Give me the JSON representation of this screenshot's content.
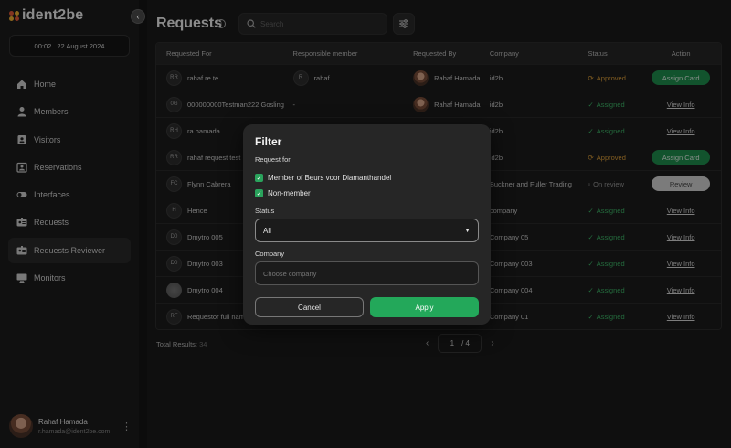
{
  "app": {
    "logo_text": "ident2be"
  },
  "sidebar": {
    "time": "00:02",
    "date": "22 August 2024",
    "items": [
      {
        "label": "Home",
        "icon": "home-icon"
      },
      {
        "label": "Members",
        "icon": "person-icon"
      },
      {
        "label": "Visitors",
        "icon": "badge-icon"
      },
      {
        "label": "Reservations",
        "icon": "calendar-person-icon"
      },
      {
        "label": "Interfaces",
        "icon": "toggle-icon"
      },
      {
        "label": "Requests",
        "icon": "id-card-icon"
      },
      {
        "label": "Requests Reviewer",
        "icon": "id-card-check-icon",
        "active": true
      },
      {
        "label": "Monitors",
        "icon": "monitor-icon"
      }
    ],
    "user": {
      "name": "Rahaf Hamada",
      "email": "r.hamada@ident2be.com"
    }
  },
  "header": {
    "title": "Requests",
    "search_placeholder": "Search"
  },
  "table": {
    "columns": [
      "Requested For",
      "Responsible member",
      "Requested By",
      "Company",
      "Status",
      "Action"
    ],
    "rows": [
      {
        "initials": "RR",
        "requested_for": "rahaf re te",
        "resp_initials": "R",
        "responsible": "rahaf",
        "requested_by": "Rahaf Hamada",
        "company": "id2b",
        "status": "Approved",
        "action": "Assign Card"
      },
      {
        "initials": "0G",
        "requested_for": "000000000Testman222 Gosling",
        "resp_initials": "",
        "responsible": "-",
        "requested_by": "Rahaf Hamada",
        "company": "id2b",
        "status": "Assigned",
        "action": "View Info"
      },
      {
        "initials": "RH",
        "requested_for": "ra hamada",
        "resp_initials": "",
        "responsible": "",
        "requested_by": "",
        "company": "id2b",
        "status": "Assigned",
        "action": "View Info"
      },
      {
        "initials": "RR",
        "requested_for": "rahaf request test",
        "resp_initials": "",
        "responsible": "",
        "requested_by": "",
        "company": "id2b",
        "status": "Approved",
        "action": "Assign Card"
      },
      {
        "initials": "FC",
        "requested_for": "Flynn Cabrera",
        "resp_initials": "",
        "responsible": "",
        "requested_by": "",
        "company": "Buckner and Fuller Trading",
        "status": "On review",
        "action": "Review"
      },
      {
        "initials": "H",
        "requested_for": "Hence",
        "resp_initials": "",
        "responsible": "",
        "requested_by": "",
        "company": "company",
        "status": "Assigned",
        "action": "View Info"
      },
      {
        "initials": "D0",
        "requested_for": "Dmytro 005",
        "resp_initials": "",
        "responsible": "",
        "requested_by": "",
        "company": "Company 05",
        "status": "Assigned",
        "action": "View Info"
      },
      {
        "initials": "D0",
        "requested_for": "Dmytro 003",
        "resp_initials": "",
        "responsible": "",
        "requested_by": "",
        "company": "Company 003",
        "status": "Assigned",
        "action": "View Info"
      },
      {
        "initials": "",
        "requested_for": "Dmytro 004",
        "resp_initials": "",
        "responsible": "",
        "requested_by": "",
        "company": "Company 004",
        "status": "Assigned",
        "action": "View Info"
      },
      {
        "initials": "RF",
        "requested_for": "Requestor full nam",
        "resp_initials": "",
        "responsible": "",
        "requested_by": "",
        "company": "Company 01",
        "status": "Assigned",
        "action": "View Info"
      }
    ]
  },
  "footer": {
    "total_label": "Total Results:",
    "total_value": "34",
    "page_current": "1",
    "page_total": "/ 4"
  },
  "filter_modal": {
    "title": "Filter",
    "request_for_label": "Request for",
    "options": [
      {
        "label": "Member of Beurs voor Diamanthandel",
        "checked": true
      },
      {
        "label": "Non-member",
        "checked": true
      }
    ],
    "status_label": "Status",
    "status_value": "All",
    "company_label": "Company",
    "company_placeholder": "Choose company",
    "cancel_label": "Cancel",
    "apply_label": "Apply"
  },
  "colors": {
    "accent_green": "#23a85a",
    "approved": "#e0a13a",
    "assigned": "#3fb96a"
  }
}
